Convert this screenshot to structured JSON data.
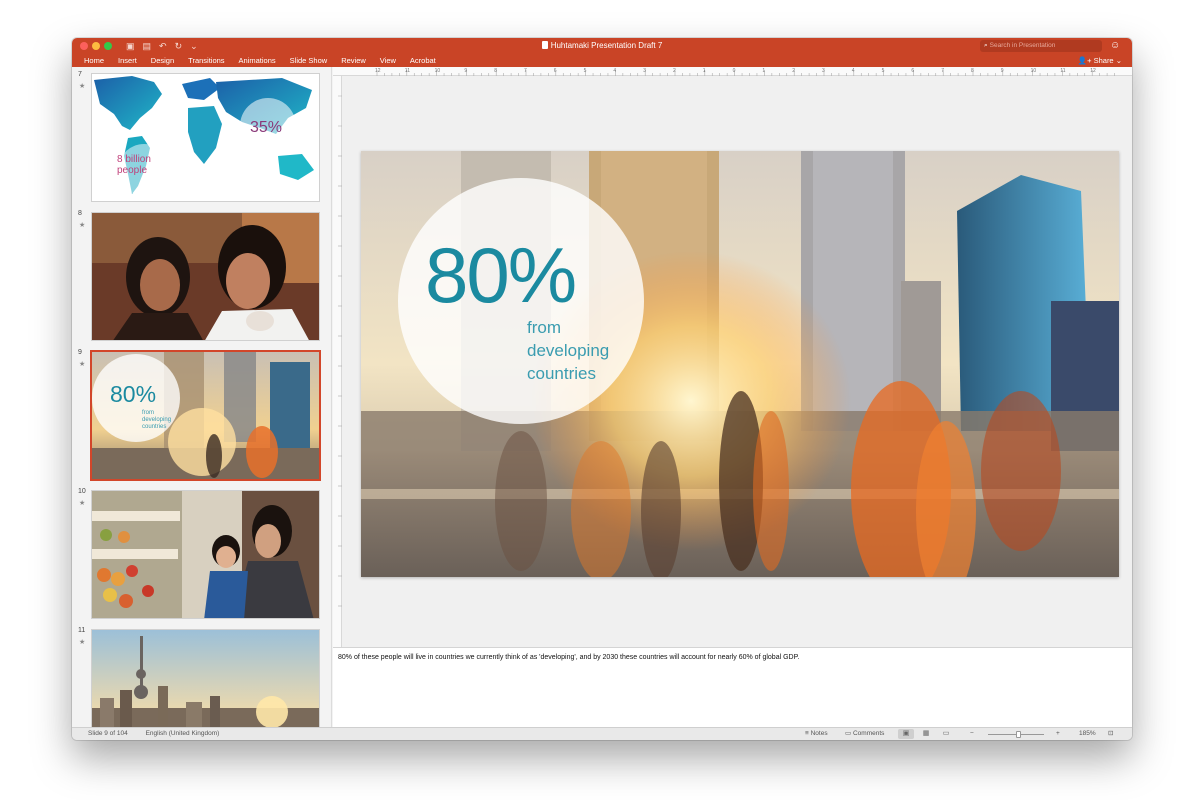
{
  "window": {
    "title": "Huhtamaki Presentation Draft 7",
    "search_placeholder": "Search in Presentation",
    "accent": "#c94426"
  },
  "toolbar": {
    "icons": [
      "sidebar-toggle-icon",
      "save-icon",
      "undo-icon",
      "redo-icon",
      "customize-icon"
    ]
  },
  "ribbon": {
    "tabs": [
      "Home",
      "Insert",
      "Design",
      "Transitions",
      "Animations",
      "Slide Show",
      "Review",
      "View",
      "Acrobat"
    ],
    "share_label": "Share"
  },
  "ruler": {
    "labels": [
      "12",
      "11",
      "10",
      "9",
      "8",
      "7",
      "6",
      "5",
      "4",
      "3",
      "2",
      "1",
      "0",
      "1",
      "2",
      "3",
      "4",
      "5",
      "6",
      "7",
      "8",
      "9",
      "10",
      "11",
      "12"
    ]
  },
  "thumbnails": [
    {
      "number": "7",
      "star": "★",
      "big_text": "35%",
      "caption_line1": "8 billion",
      "caption_line2": "people"
    },
    {
      "number": "8",
      "star": "★"
    },
    {
      "number": "9",
      "star": "★",
      "big_text": "80%",
      "line1": "from",
      "line2": "developing",
      "line3": "countries",
      "selected": true
    },
    {
      "number": "10",
      "star": "★"
    },
    {
      "number": "11",
      "star": "★"
    }
  ],
  "slide": {
    "big_text": "80%",
    "line1": "from",
    "line2": "developing",
    "line3": "countries"
  },
  "notes": {
    "text": "80% of these people will live in countries we currently think of as 'developing', and by 2030 these countries will account for nearly 60% of global GDP."
  },
  "statusbar": {
    "slide_info": "Slide 9 of 104",
    "language": "English (United Kingdom)",
    "notes_label": "Notes",
    "comments_label": "Comments",
    "zoom_minus": "−",
    "zoom_plus": "+",
    "zoom_level": "185%",
    "zoom_fraction": 0.55
  }
}
